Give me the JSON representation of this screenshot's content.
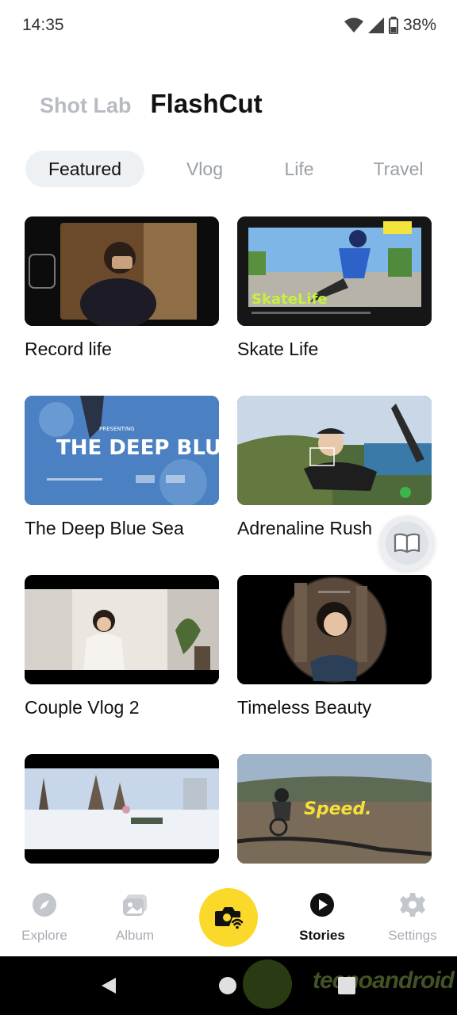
{
  "status_bar": {
    "time": "14:35",
    "battery": "38%",
    "icons": [
      "wifi-icon",
      "cell-signal-icon",
      "battery-icon"
    ]
  },
  "header": {
    "secondary_title": "Shot Lab",
    "primary_title": "FlashCut"
  },
  "tabs": [
    {
      "label": "Featured",
      "active": true
    },
    {
      "label": "Vlog",
      "active": false
    },
    {
      "label": "Life",
      "active": false
    },
    {
      "label": "Travel",
      "active": false
    }
  ],
  "cards": [
    {
      "title": "Record life"
    },
    {
      "title": "Skate Life"
    },
    {
      "title": "The Deep Blue Sea"
    },
    {
      "title": "Adrenaline Rush"
    },
    {
      "title": "Couple Vlog 2"
    },
    {
      "title": "Timeless Beauty"
    },
    {
      "title": ""
    },
    {
      "title": ""
    }
  ],
  "thumb_text": {
    "skate": "SkateLife",
    "deep_blue": "THE DEEP BLUE",
    "presenting": "PRESENTING",
    "speed": "Speed."
  },
  "bottom_nav": [
    {
      "label": "Explore",
      "icon": "compass-icon",
      "active": false
    },
    {
      "label": "Album",
      "icon": "album-icon",
      "active": false
    },
    {
      "label": "",
      "icon": "camera-wifi-icon",
      "active": false
    },
    {
      "label": "Stories",
      "icon": "play-circle-icon",
      "active": true
    },
    {
      "label": "Settings",
      "icon": "gear-icon",
      "active": false
    }
  ],
  "watermark": "tecnoandroid",
  "colors": {
    "accent_yellow": "#fbd92a",
    "inactive_gray": "#9aa0a6",
    "active_tab_bg": "#eef1f4"
  }
}
